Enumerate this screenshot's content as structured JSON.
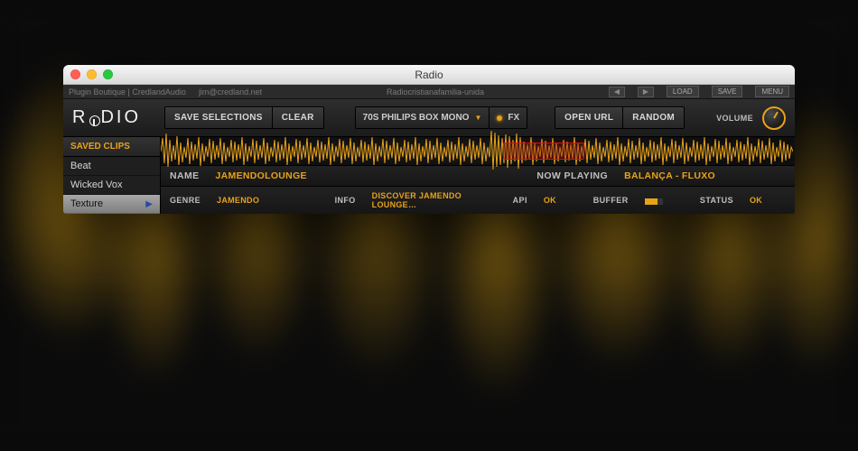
{
  "window": {
    "title": "Radio"
  },
  "pluginbar": {
    "left": "Plugin Boutique | CredlandAudio",
    "user": "jim@credland.net",
    "preset": "Radiocristianafamilia-unida",
    "load": "LOAD",
    "save": "SAVE",
    "menu": "MENU"
  },
  "logo": {
    "pre": "R",
    "post": "DIO"
  },
  "toolbar": {
    "save_selections": "SAVE SELECTIONS",
    "clear": "CLEAR",
    "device": "70S PHILIPS BOX MONO",
    "fx": "FX",
    "open_url": "OPEN URL",
    "random": "RANDOM",
    "volume": "VOLUME"
  },
  "sidebar": {
    "header": "SAVED CLIPS",
    "items": [
      {
        "label": "Beat"
      },
      {
        "label": "Wicked Vox"
      },
      {
        "label": "Texture",
        "selected": true
      }
    ]
  },
  "info": {
    "name_label": "NAME",
    "name_value": "JAMENDOLOUNGE",
    "now_label": "NOW PLAYING",
    "now_value": "BALANÇA - FLUXO",
    "genre_label": "GENRE",
    "genre_value": "JAMENDO",
    "info_label": "INFO",
    "info_value": "DISCOVER JAMENDO LOUNGE…",
    "api_label": "API",
    "api_value": "OK",
    "buffer_label": "BUFFER",
    "status_label": "STATUS",
    "status_value": "OK"
  },
  "colors": {
    "accent": "#e8a21a"
  }
}
